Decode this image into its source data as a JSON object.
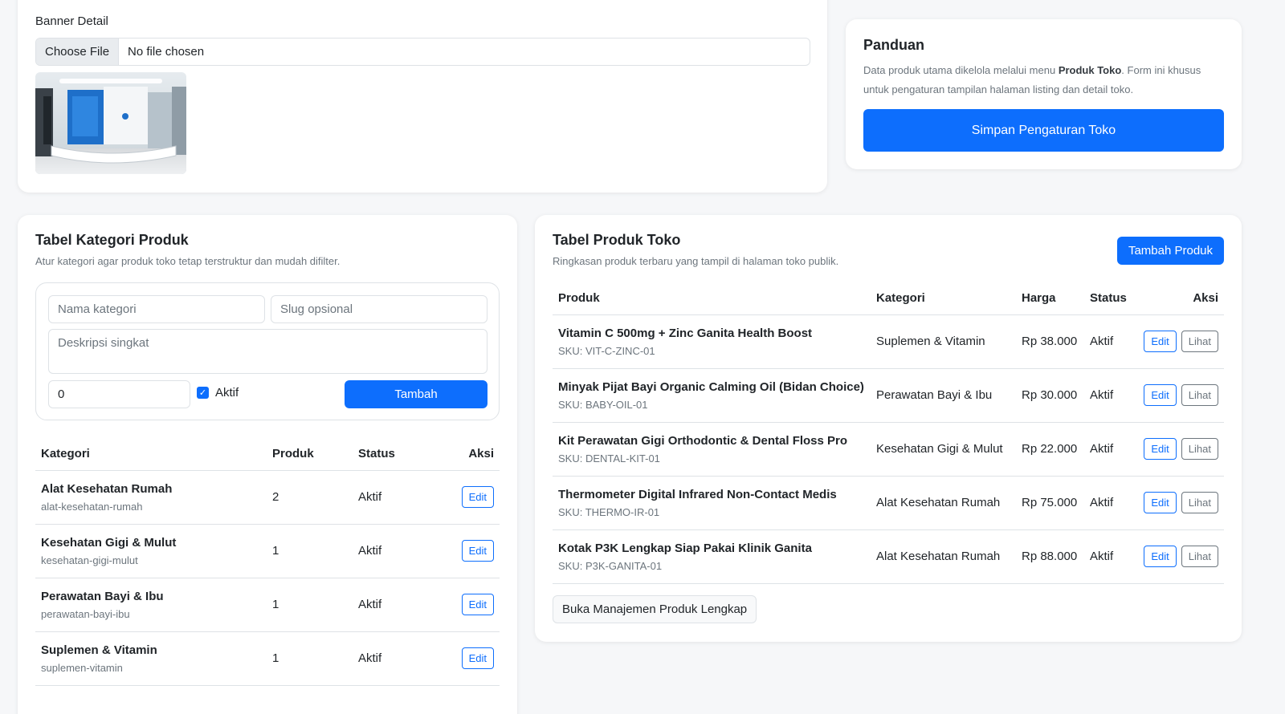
{
  "banner": {
    "label": "Banner Detail",
    "file_button": "Choose File",
    "file_status": "No file chosen"
  },
  "guide": {
    "title": "Panduan",
    "text_before": "Data produk utama dikelola melalui menu ",
    "text_bold": "Produk Toko",
    "text_after": ". Form ini khusus untuk pengaturan tampilan halaman listing dan detail toko.",
    "save_button": "Simpan Pengaturan Toko"
  },
  "categories": {
    "title": "Tabel Kategori Produk",
    "subtitle": "Atur kategori agar produk toko tetap terstruktur dan mudah difilter.",
    "form": {
      "name_placeholder": "Nama kategori",
      "slug_placeholder": "Slug opsional",
      "desc_placeholder": "Deskripsi singkat",
      "order_value": "0",
      "active_label": "Aktif",
      "add_button": "Tambah"
    },
    "headers": [
      "Kategori",
      "Produk",
      "Status",
      "Aksi"
    ],
    "rows": [
      {
        "name": "Alat Kesehatan Rumah",
        "slug": "alat-kesehatan-rumah",
        "count": "2",
        "status": "Aktif",
        "action": "Edit"
      },
      {
        "name": "Kesehatan Gigi & Mulut",
        "slug": "kesehatan-gigi-mulut",
        "count": "1",
        "status": "Aktif",
        "action": "Edit"
      },
      {
        "name": "Perawatan Bayi & Ibu",
        "slug": "perawatan-bayi-ibu",
        "count": "1",
        "status": "Aktif",
        "action": "Edit"
      },
      {
        "name": "Suplemen & Vitamin",
        "slug": "suplemen-vitamin",
        "count": "1",
        "status": "Aktif",
        "action": "Edit"
      }
    ]
  },
  "products": {
    "title": "Tabel Produk Toko",
    "subtitle": "Ringkasan produk terbaru yang tampil di halaman toko publik.",
    "add_button": "Tambah Produk",
    "headers": [
      "Produk",
      "Kategori",
      "Harga",
      "Status",
      "Aksi"
    ],
    "rows": [
      {
        "name": "Vitamin C 500mg + Zinc Ganita Health Boost",
        "sku": "SKU: VIT-C-ZINC-01",
        "category": "Suplemen & Vitamin",
        "price": "Rp 38.000",
        "status": "Aktif",
        "edit": "Edit",
        "view": "Lihat"
      },
      {
        "name": "Minyak Pijat Bayi Organic Calming Oil (Bidan Choice)",
        "sku": "SKU: BABY-OIL-01",
        "category": "Perawatan Bayi & Ibu",
        "price": "Rp 30.000",
        "status": "Aktif",
        "edit": "Edit",
        "view": "Lihat"
      },
      {
        "name": "Kit Perawatan Gigi Orthodontic & Dental Floss Pro",
        "sku": "SKU: DENTAL-KIT-01",
        "category": "Kesehatan Gigi & Mulut",
        "price": "Rp 22.000",
        "status": "Aktif",
        "edit": "Edit",
        "view": "Lihat"
      },
      {
        "name": "Thermometer Digital Infrared Non-Contact Medis",
        "sku": "SKU: THERMO-IR-01",
        "category": "Alat Kesehatan Rumah",
        "price": "Rp 75.000",
        "status": "Aktif",
        "edit": "Edit",
        "view": "Lihat"
      },
      {
        "name": "Kotak P3K Lengkap Siap Pakai Klinik Ganita",
        "sku": "SKU: P3K-GANITA-01",
        "category": "Alat Kesehatan Rumah",
        "price": "Rp 88.000",
        "status": "Aktif",
        "edit": "Edit",
        "view": "Lihat"
      }
    ],
    "manage_button": "Buka Manajemen Produk Lengkap"
  },
  "colors": {
    "primary": "#0d6efd",
    "muted": "#6c757d",
    "border": "#dee2e6"
  }
}
